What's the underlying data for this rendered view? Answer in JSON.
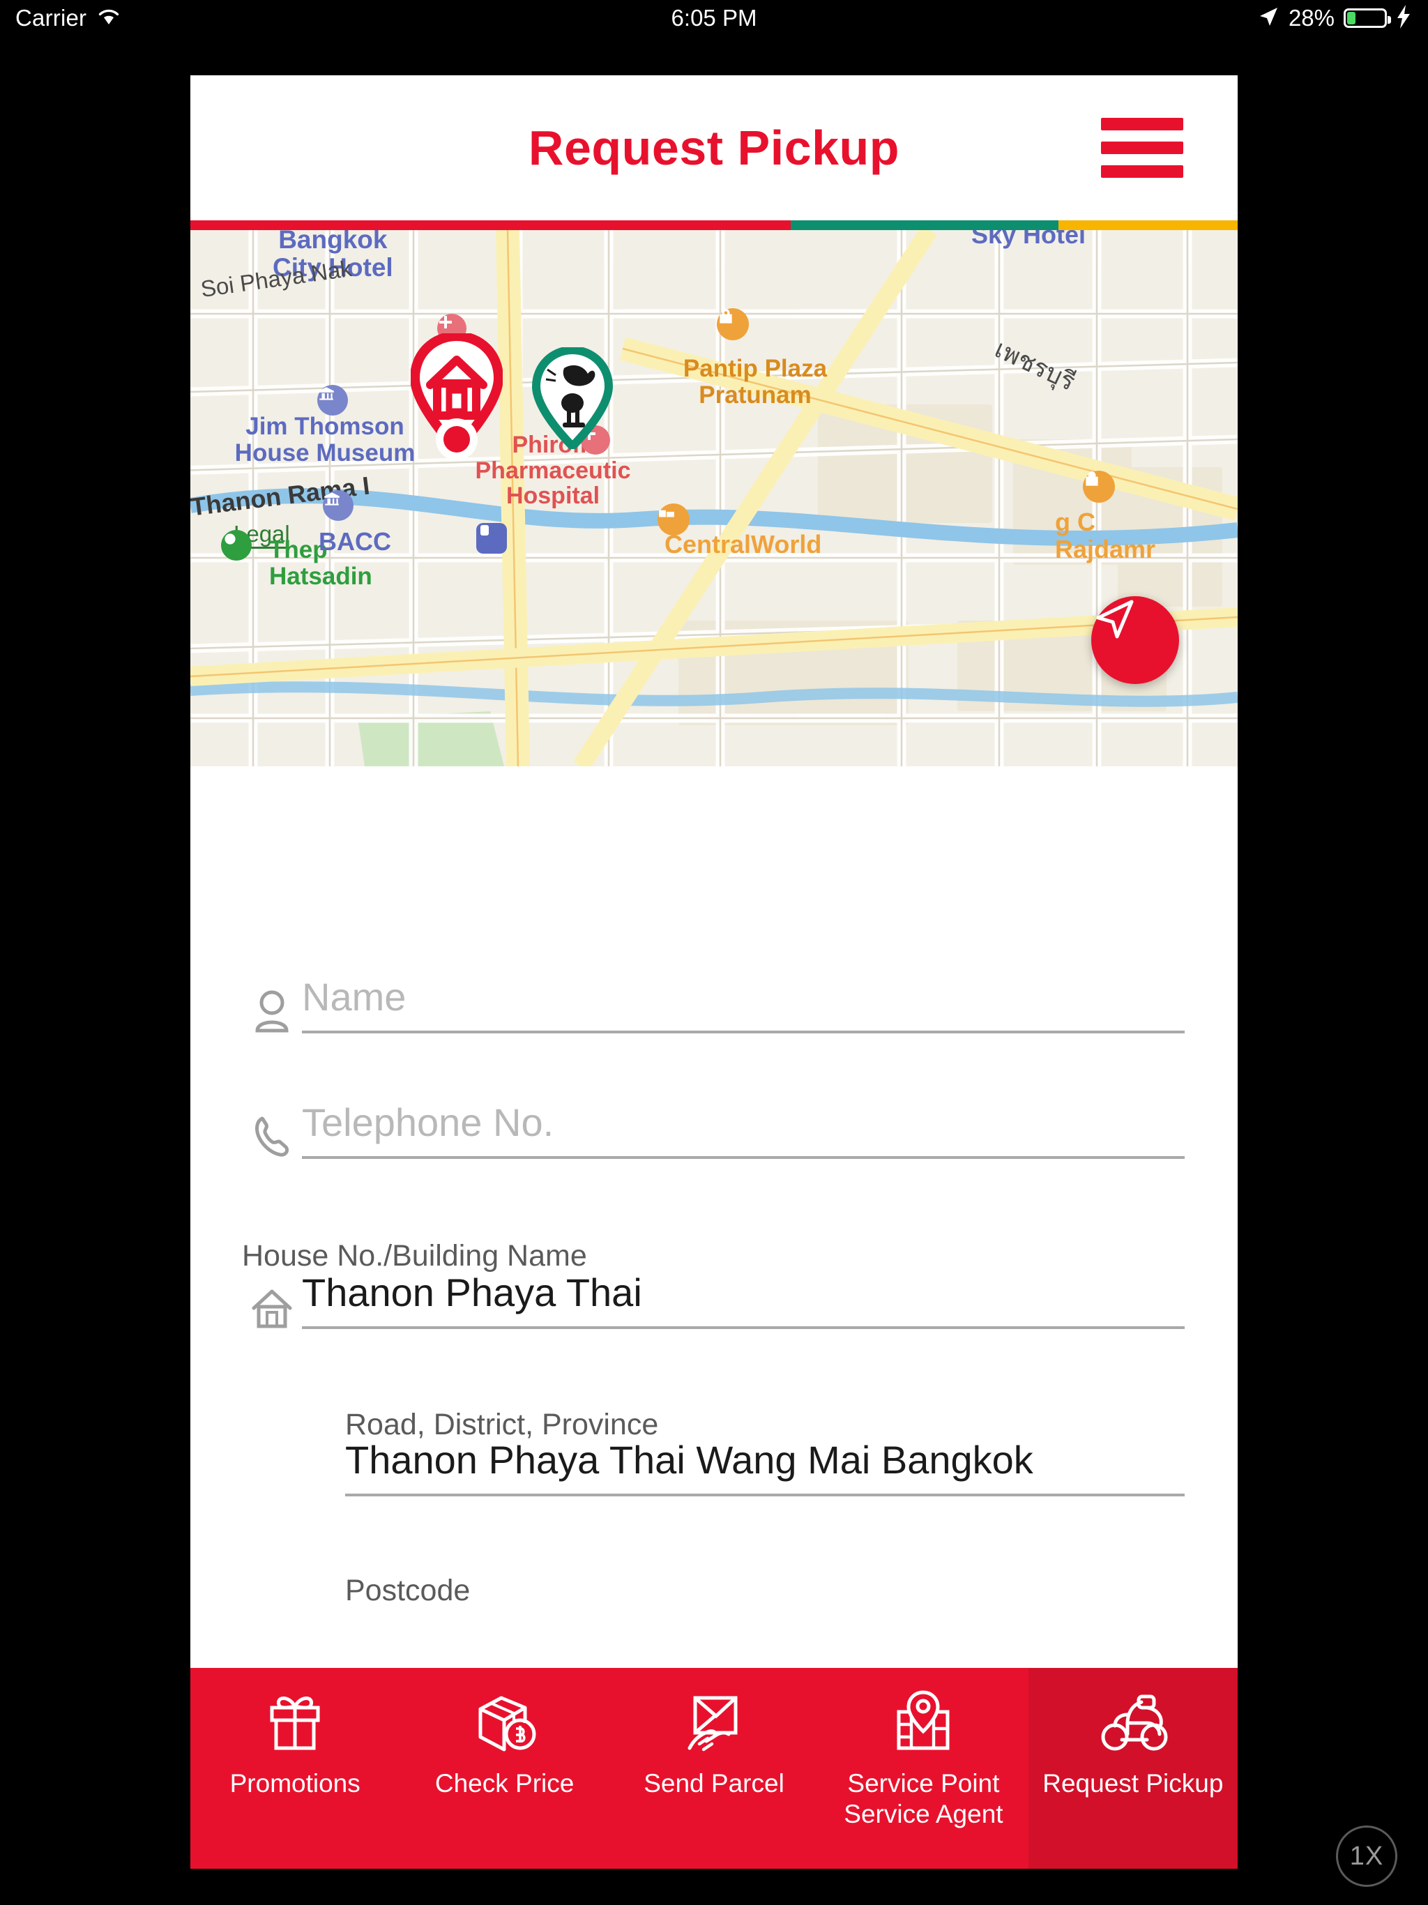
{
  "status_bar": {
    "carrier": "Carrier",
    "wifi_icon": "wifi-icon",
    "time": "6:05 PM",
    "location_icon": "location-arrow-icon",
    "battery_percent": "28%",
    "battery_level": 28,
    "charging_icon": "lightning-bolt-icon"
  },
  "header": {
    "title": "Request Pickup",
    "menu_icon": "hamburger-menu-icon",
    "title_color": "#E8112D"
  },
  "brand_bar": {
    "red": "#E8112D",
    "green": "#0D8F6F",
    "yellow": "#F7B500"
  },
  "map": {
    "my_location_icon": "navigation-arrow-icon",
    "home_pin_icon": "house-pin-icon",
    "kerry_pin_icon": "kerry-cat-pin-icon",
    "labels": [
      {
        "text": "Bangkok\nCity Hotel",
        "color": "#5C6BC0"
      },
      {
        "text": "Soi Phaya Nak",
        "color": "#4A4A4A"
      },
      {
        "text": "Sky Hotel",
        "color": "#5C6BC0"
      },
      {
        "text": "Pantip Plaza\nPratunam",
        "color": "#D98B1E"
      },
      {
        "text": "เพชรบุรี",
        "color": "#4A4A4A"
      },
      {
        "text": "Jim Thomson\nHouse Museum",
        "color": "#5C6BC0"
      },
      {
        "text": "Phirom\nPharmaceutic\nHospital",
        "color": "#E05252"
      },
      {
        "text": "Thanon Rama I",
        "color": "#3A3A3A"
      },
      {
        "text": "Legal",
        "color": "#2E7D32"
      },
      {
        "text": "Thep\nHatsadin",
        "color": "#2E9E3E"
      },
      {
        "text": "BACC",
        "color": "#5C6BC0"
      },
      {
        "text": "CentralWorld",
        "color": "#EFA23A"
      },
      {
        "text": "g C\nRajdamr",
        "color": "#EFA23A"
      }
    ]
  },
  "form": {
    "name": {
      "icon": "person-icon",
      "label": "",
      "placeholder": "Name",
      "value": ""
    },
    "telephone": {
      "icon": "phone-icon",
      "label": "",
      "placeholder": "Telephone No.",
      "value": ""
    },
    "house": {
      "icon": "home-icon",
      "label": "House No./Building Name",
      "value": "Thanon Phaya Thai"
    },
    "road": {
      "label": "Road, District, Province",
      "value": "Thanon Phaya Thai Wang Mai Bangkok"
    },
    "postcode": {
      "label": "Postcode",
      "value": ""
    }
  },
  "bottom_nav": {
    "background": "#E8112D",
    "active_background": "#D2102A",
    "items": [
      {
        "icon": "gift-icon",
        "label": "Promotions",
        "active": false
      },
      {
        "icon": "box-baht-icon",
        "label": "Check\nPrice",
        "active": false
      },
      {
        "icon": "hand-parcel-icon",
        "label": "Send\nParcel",
        "active": false
      },
      {
        "icon": "map-pin-icon",
        "label": "Service Point\nService Agent",
        "active": false
      },
      {
        "icon": "scooter-icon",
        "label": "Request\nPickup",
        "active": true
      }
    ]
  },
  "scale_badge": {
    "label": "1X"
  }
}
